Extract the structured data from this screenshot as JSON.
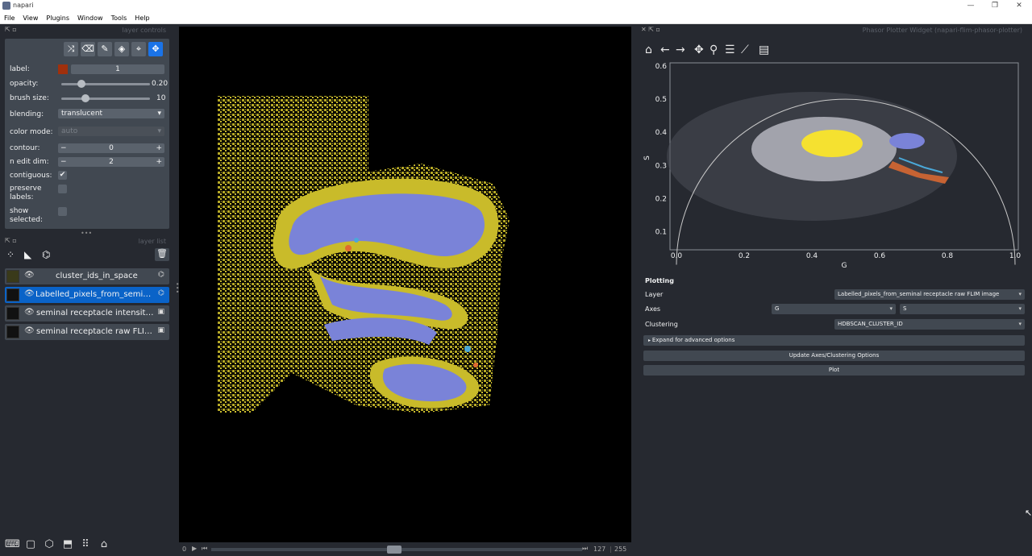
{
  "window": {
    "title": "napari",
    "min": "—",
    "max": "❐",
    "close": "✕"
  },
  "menu": [
    "File",
    "View",
    "Plugins",
    "Window",
    "Tools",
    "Help"
  ],
  "layer_controls": {
    "title": "layer controls",
    "label_label": "label:",
    "label_value": "1",
    "opacity_label": "opacity:",
    "opacity_value": "0.20",
    "opacity_fraction": 0.2,
    "brush_label": "brush size:",
    "brush_value": "10",
    "brush_fraction": 0.25,
    "blending_label": "blending:",
    "blending_value": "translucent",
    "colormode_label": "color mode:",
    "colormode_value": "auto",
    "contour_label": "contour:",
    "contour_value": "0",
    "nedit_label": "n edit dim:",
    "nedit_value": "2",
    "contiguous_label": "contiguous:",
    "preserve_label": "preserve labels:",
    "show_label": "show selected:"
  },
  "layer_list": {
    "title": "layer list",
    "layers": [
      {
        "name": "cluster_ids_in_space",
        "selected": false
      },
      {
        "name": "Labelled_pixels_from_semina...",
        "selected": true
      },
      {
        "name": "seminal receptacle intensity i...",
        "selected": false
      },
      {
        "name": "seminal receptacle raw FLIM...",
        "selected": false
      }
    ]
  },
  "dims": {
    "start": "0",
    "current": "127",
    "total": "255"
  },
  "plotter": {
    "title": "Phasor Plotter Widget (napari-flim-phasor-plotter)",
    "xlabel": "G",
    "ylabel": "S",
    "xticks": [
      "0.0",
      "0.2",
      "0.4",
      "0.6",
      "0.8",
      "1.0"
    ],
    "yticks": [
      "0.1",
      "0.2",
      "0.3",
      "0.4",
      "0.5",
      "0.6"
    ],
    "plotting_title": "Plotting",
    "layer_label": "Layer",
    "layer_value": "Labelled_pixels_from_seminal receptacle raw FLIM image",
    "axes_label": "Axes",
    "axes_x": "G",
    "axes_y": "S",
    "clustering_label": "Clustering",
    "clustering_value": "HDBSCAN_CLUSTER_ID",
    "expand_label": "Expand for advanced options",
    "update_label": "Update Axes/Clustering Options",
    "plot_label": "Plot"
  },
  "colors": {
    "accent": "#0a63c8",
    "cluster_yellow": "#f5e130",
    "cluster_blue": "#7a83d8",
    "label_swatch": "#a0300c"
  }
}
